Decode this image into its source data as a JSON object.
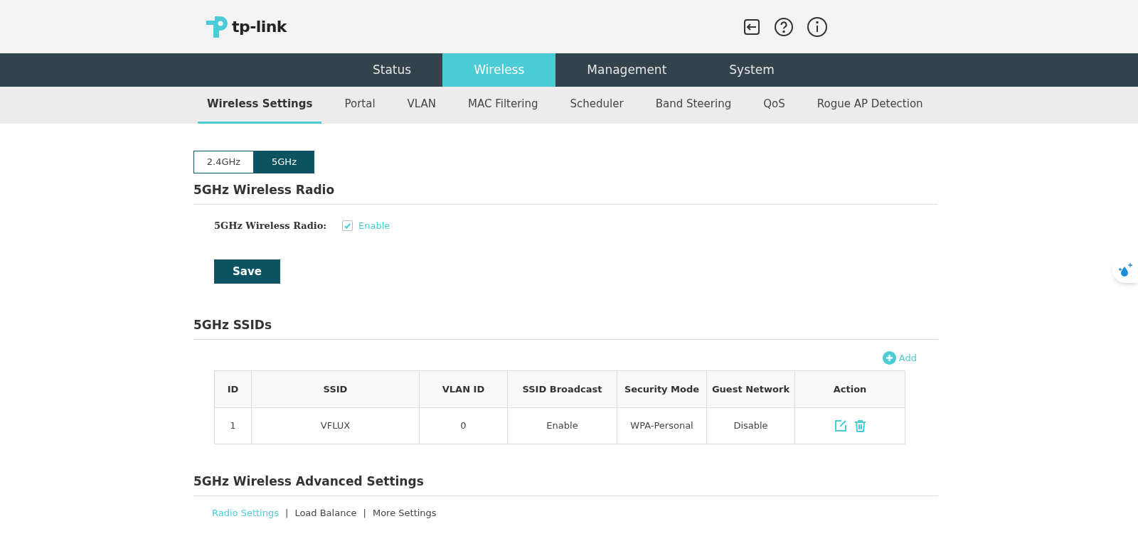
{
  "header": {
    "logo_text": "tp-link"
  },
  "main_nav": [
    {
      "label": "Status",
      "selected": false
    },
    {
      "label": "Wireless",
      "selected": true
    },
    {
      "label": "Management",
      "selected": false
    },
    {
      "label": "System",
      "selected": false
    }
  ],
  "sub_nav": [
    {
      "label": "Wireless Settings",
      "selected": true
    },
    {
      "label": "Portal",
      "selected": false
    },
    {
      "label": "VLAN",
      "selected": false
    },
    {
      "label": "MAC Filtering",
      "selected": false
    },
    {
      "label": "Scheduler",
      "selected": false
    },
    {
      "label": "Band Steering",
      "selected": false
    },
    {
      "label": "QoS",
      "selected": false
    },
    {
      "label": "Rogue AP Detection",
      "selected": false
    }
  ],
  "band_tabs": [
    {
      "label": "2.4GHz",
      "selected": false
    },
    {
      "label": "5GHz",
      "selected": true
    }
  ],
  "radio_section": {
    "title": "5GHz Wireless Radio",
    "field_label": "5GHz Wireless Radio:",
    "checkbox_label": "Enable",
    "checked": true,
    "save": "Save"
  },
  "ssid_section": {
    "title": "5GHz SSIDs",
    "add": "Add",
    "table": {
      "columns": [
        "ID",
        "SSID",
        "VLAN ID",
        "SSID Broadcast",
        "Security Mode",
        "Guest Network",
        "Action"
      ],
      "rows": [
        {
          "cells": [
            "1",
            "VFLUX",
            "0",
            "Enable",
            "WPA-Personal",
            "Disable"
          ]
        }
      ]
    }
  },
  "advanced_section": {
    "title": "5GHz Wireless Advanced Settings",
    "links": [
      {
        "label": "Radio Settings",
        "selected": true
      },
      {
        "label": "Load Balance",
        "selected": false
      },
      {
        "label": "More Settings",
        "selected": false
      }
    ],
    "separator": "|"
  }
}
